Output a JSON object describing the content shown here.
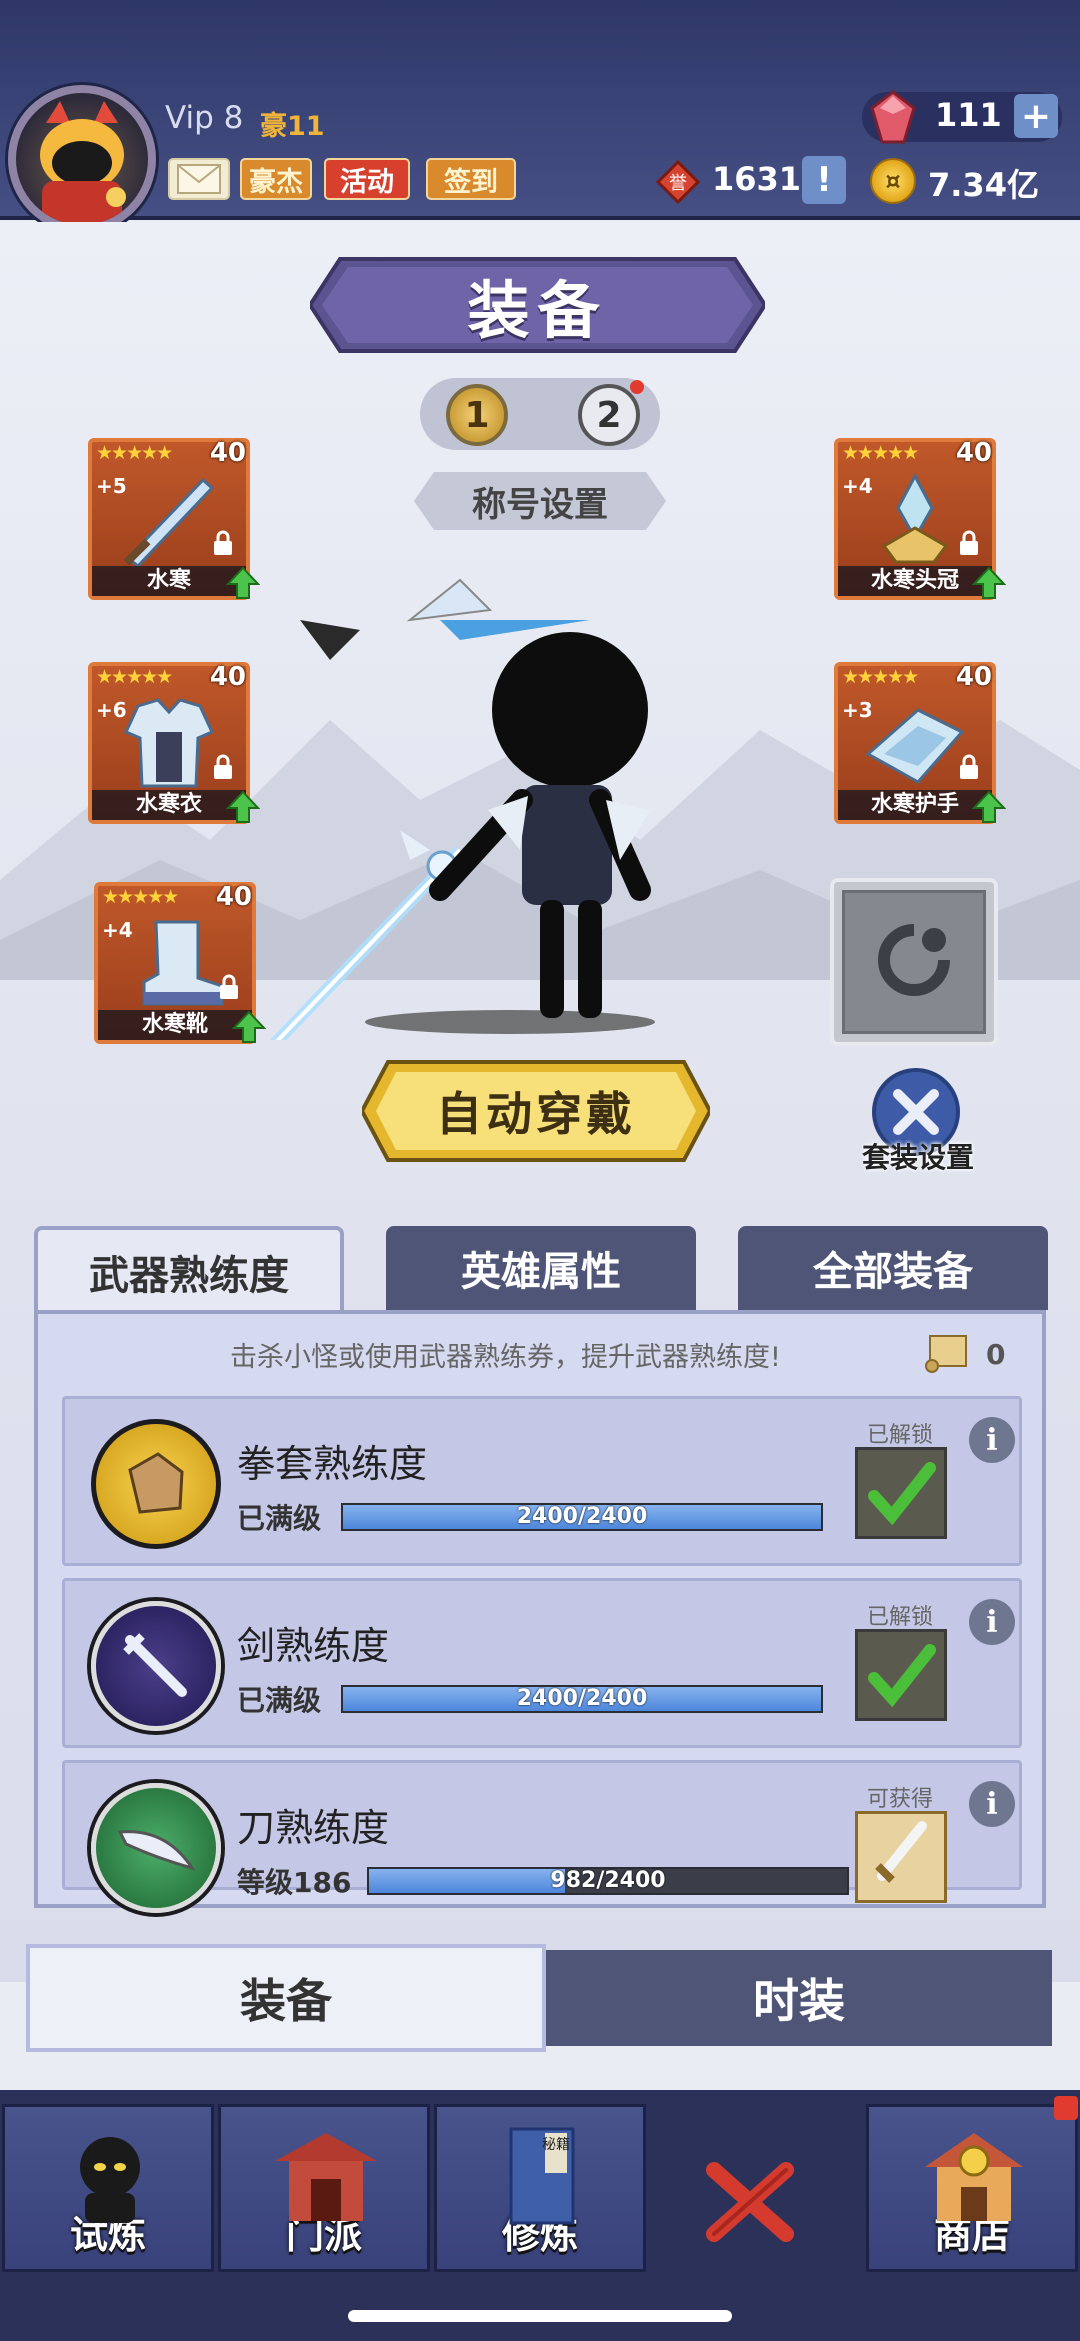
{
  "header": {
    "vip_label": "Vip 8",
    "hao_label": "豪11",
    "haojie_label": "豪杰",
    "activity_label": "活动",
    "signin_label": "签到",
    "gems": "111",
    "gem_plus": "+",
    "honor_points": "1631",
    "honor_info": "!",
    "gold": "7.34亿",
    "gold_icon_glyph": "¤"
  },
  "equipment": {
    "title": "装备",
    "pages": [
      "1",
      "2"
    ],
    "title_setting": "称号设置",
    "slots": [
      {
        "name": "水寒",
        "stars": "★★★★★",
        "level": "40",
        "plus": "+5"
      },
      {
        "name": "水寒头冠",
        "stars": "★★★★★",
        "level": "40",
        "plus": "+4"
      },
      {
        "name": "水寒衣",
        "stars": "★★★★★",
        "level": "40",
        "plus": "+6"
      },
      {
        "name": "水寒护手",
        "stars": "★★★★★",
        "level": "40",
        "plus": "+3"
      },
      {
        "name": "水寒靴",
        "stars": "★★★★★",
        "level": "40",
        "plus": "+4"
      }
    ],
    "auto_equip_label": "自动穿戴",
    "set_label": "套装设置"
  },
  "tabs": {
    "mastery": "武器熟练度",
    "hero_attributes": "英雄属性",
    "all_equipment": "全部装备"
  },
  "mastery": {
    "hint": "击杀小怪或使用武器熟练券，提升武器熟练度!",
    "scroll_count": "0",
    "rows": [
      {
        "title": "拳套熟练度",
        "sub": "已满级",
        "progress": "2400/2400",
        "fraction": 1.0,
        "status": "已解锁"
      },
      {
        "title": "剑熟练度",
        "sub": "已满级",
        "progress": "2400/2400",
        "fraction": 1.0,
        "status": "已解锁"
      },
      {
        "title": "刀熟练度",
        "sub": "等级186",
        "progress": "982/2400",
        "fraction": 0.409,
        "status": "可获得"
      }
    ]
  },
  "subtabs": {
    "equip": "装备",
    "fashion": "时装"
  },
  "nav": {
    "trial": "试炼",
    "sect": "门派",
    "practice": "修炼",
    "practice_book": "秘籍",
    "shop": "商店"
  },
  "colors": {
    "header_bg": "#3c4679",
    "slot_orange": "#c0582a",
    "progress_blue": "#4d86db",
    "tab_dark": "#4e5576",
    "badge_red": "#e13b2f"
  }
}
